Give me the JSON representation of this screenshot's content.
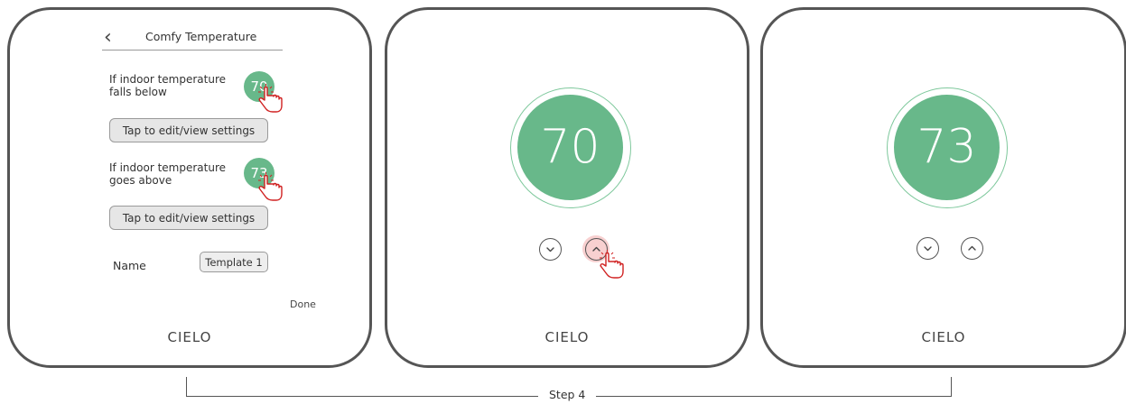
{
  "screen": {
    "back_icon": "chevron-left-icon",
    "title": "Comfy Temperature",
    "conditions": [
      {
        "label": "If indoor temperature falls below",
        "value": "70",
        "button_label": "Tap to edit/view settings"
      },
      {
        "label": "If indoor temperature goes above",
        "value": "73",
        "button_label": "Tap to edit/view settings"
      }
    ],
    "name_label": "Name",
    "name_value": "Template 1",
    "done_label": "Done"
  },
  "thermostats": [
    {
      "temperature": "70",
      "logo": "CIELO"
    },
    {
      "temperature": "73",
      "logo": "CIELO"
    }
  ],
  "device1_logo": "CIELO",
  "step_label": "Step 4",
  "colors": {
    "accent_green": "#68b88a",
    "ring_green": "#7ec89c",
    "device_border": "#555555",
    "tap_highlight": "#f09696",
    "hand_icon": "#d02020"
  }
}
